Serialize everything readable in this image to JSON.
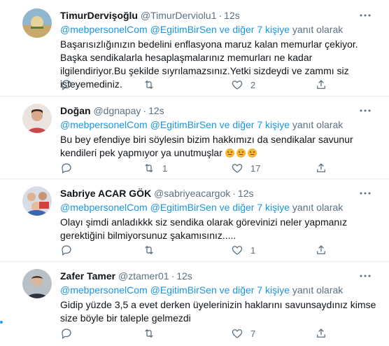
{
  "colors": {
    "accent": "#1b95e0",
    "muted": "#5b7083",
    "text": "#0f1419",
    "divider": "#ebeef0"
  },
  "tweets": [
    {
      "name": "TimurDervişoğlu",
      "handle": "@TimurDerviolu1",
      "time": "12s",
      "reply": {
        "m1": "@mebpersonelCom",
        "m2": "@EgitimBirSen",
        "others": "ve diğer 7 kişiye",
        "suffix": "yanıt olarak"
      },
      "text": "Başarısızlığınızın bedelini enflasyona maruz kalan memurlar çekiyor. Başka sendikalarla hesaplaşmalarınız memurları ne kadar ilgilendiriyor.Bu şekilde sıyrılamazsınız.Yetki sizdeydi ve zammı siz isteyemediniz.",
      "counts": {
        "reply": "",
        "retweet": "",
        "like": "2"
      }
    },
    {
      "name": "Doğan",
      "handle": "@dgnapay",
      "time": "12s",
      "reply": {
        "m1": "@mebpersonelCom",
        "m2": "@EgitimBirSen",
        "others": "ve diğer 7 kişiye",
        "suffix": "yanıt olarak"
      },
      "text": "Bu bey efendiye biri söylesin bizim hakkımızı da sendikalar savunur kendileri pek yapmıyor ya unutmuşlar",
      "emojis": [
        "thinking-face-emoji",
        "thinking-face-emoji",
        "thinking-face-emoji"
      ],
      "counts": {
        "reply": "",
        "retweet": "1",
        "like": "17"
      }
    },
    {
      "name": "Sabriye ACAR GÖK",
      "handle": "@sabriyeacargok",
      "time": "12s",
      "reply": {
        "m1": "@mebpersonelCom",
        "m2": "@EgitimBirSen",
        "others": "ve diğer 7 kişiye",
        "suffix": "yanıt olarak"
      },
      "text": "Olayı şimdi anladıkkk siz sendika olarak görevinizi neler yapmanız gerektiğini bilmiyorsunuz şakamısınız.....",
      "counts": {
        "reply": "",
        "retweet": "",
        "like": "1"
      }
    },
    {
      "name": "Zafer Tamer",
      "handle": "@ztamer01",
      "time": "12s",
      "reply": {
        "m1": "@mebpersonelCom",
        "m2": "@EgitimBirSen",
        "others": "ve diğer 7 kişiye",
        "suffix": "yanıt olarak"
      },
      "text": "Gidip yüzde 3,5 a evet derken üyelerinizin haklarını savunsaydınız kimse size böyle bir taleple gelmezdi",
      "counts": {
        "reply": "",
        "retweet": "",
        "like": "7"
      }
    }
  ]
}
